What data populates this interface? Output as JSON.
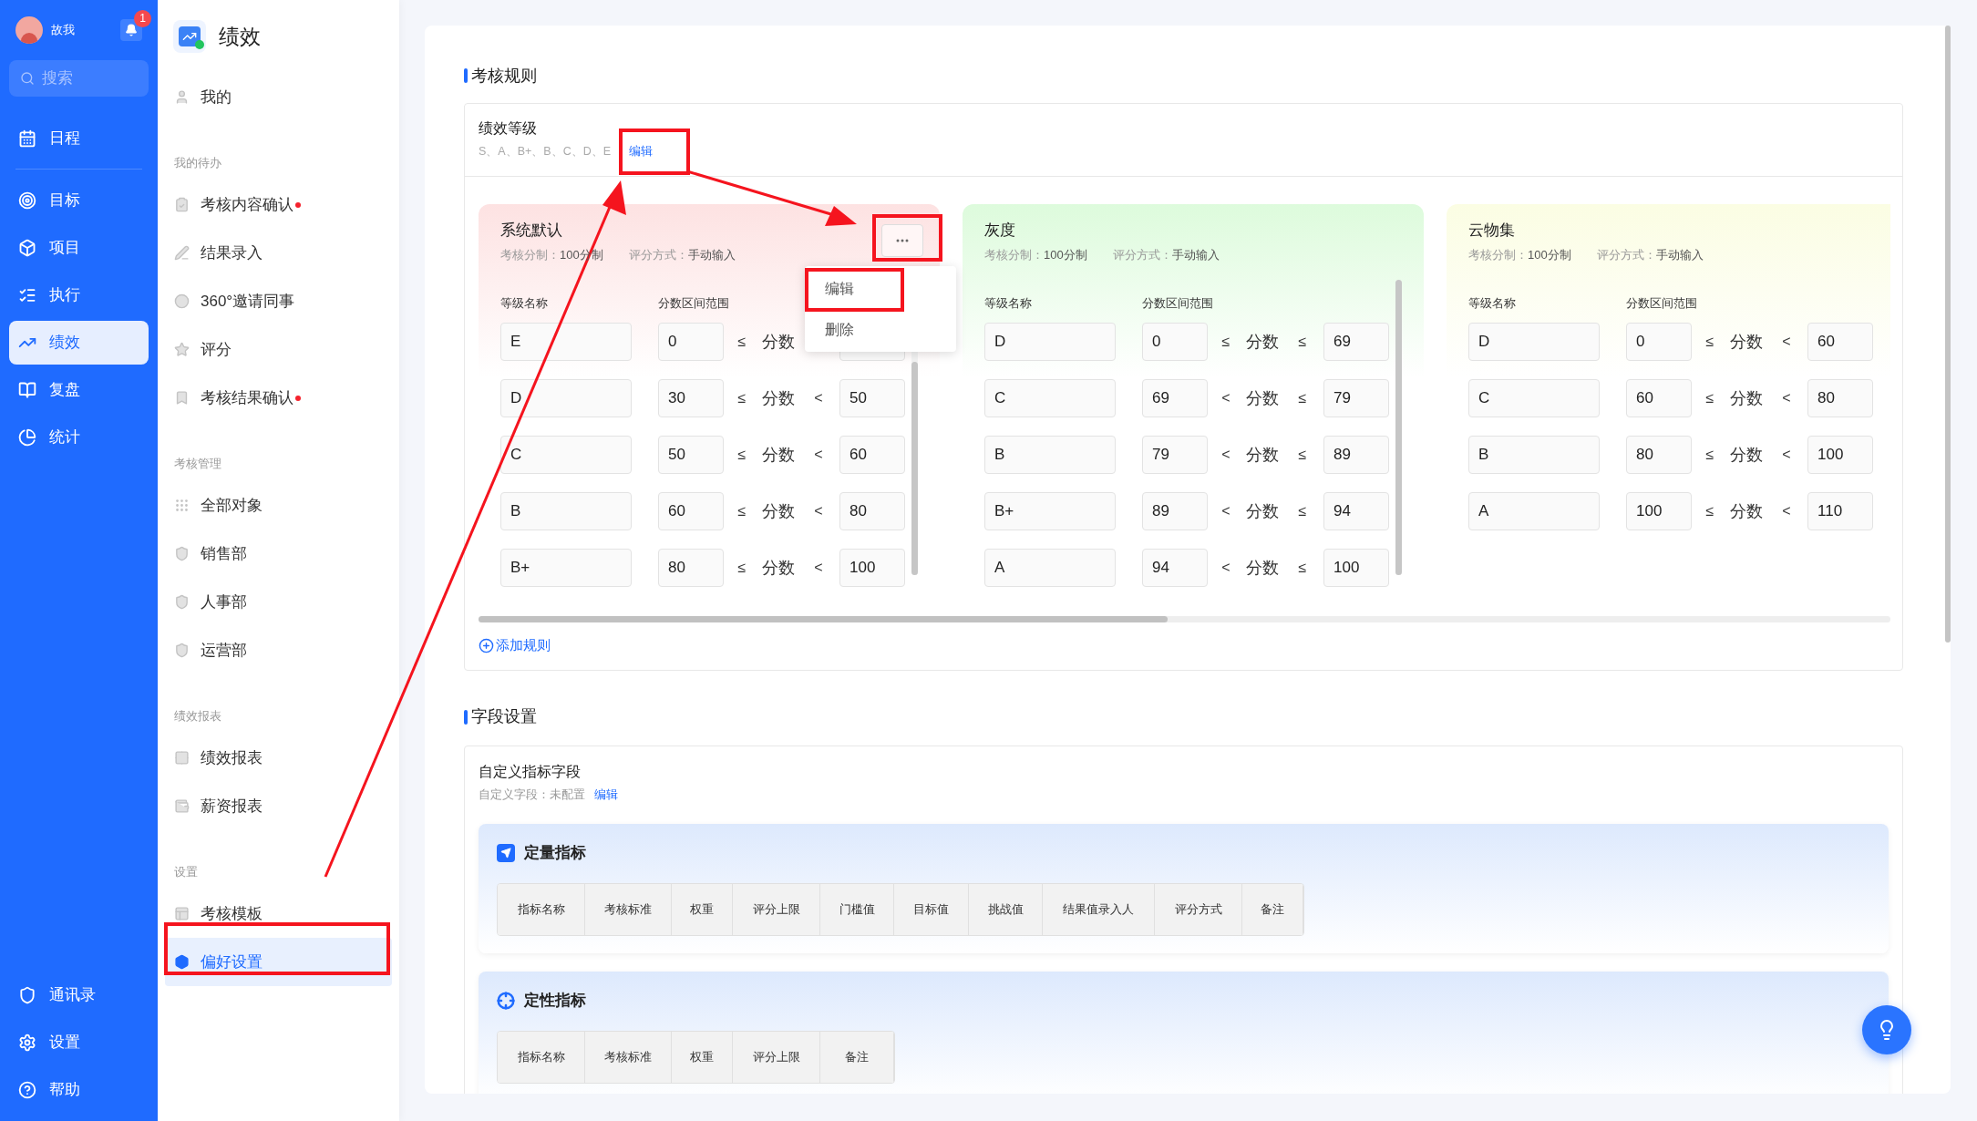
{
  "nav": {
    "user": {
      "name": "故我"
    },
    "notification_badge": "1",
    "search": {
      "placeholder": "搜索"
    },
    "top_items": [
      {
        "label": "日程",
        "selected": false
      }
    ],
    "items": [
      {
        "label": "目标",
        "selected": false
      },
      {
        "label": "项目",
        "selected": false
      },
      {
        "label": "执行",
        "selected": false
      },
      {
        "label": "绩效",
        "selected": true
      },
      {
        "label": "复盘",
        "selected": false
      },
      {
        "label": "统计",
        "selected": false
      }
    ],
    "bottom_items": [
      {
        "label": "通讯录"
      },
      {
        "label": "设置"
      },
      {
        "label": "帮助"
      }
    ]
  },
  "sidebar": {
    "title": "绩效",
    "groups": [
      {
        "items": [
          {
            "label": "我的",
            "unread": false,
            "selected": false
          }
        ]
      },
      {
        "heading": "我的待办",
        "items": [
          {
            "label": "考核内容确认",
            "unread": true,
            "selected": false
          },
          {
            "label": "结果录入",
            "unread": false,
            "selected": false
          },
          {
            "label": "360°邀请同事",
            "unread": false,
            "selected": false
          },
          {
            "label": "评分",
            "unread": false,
            "selected": false
          },
          {
            "label": "考核结果确认",
            "unread": true,
            "selected": false
          }
        ]
      },
      {
        "heading": "考核管理",
        "items": [
          {
            "label": "全部对象",
            "unread": false,
            "selected": false
          },
          {
            "label": "销售部",
            "unread": false,
            "selected": false
          },
          {
            "label": "人事部",
            "unread": false,
            "selected": false
          },
          {
            "label": "运营部",
            "unread": false,
            "selected": false
          }
        ]
      },
      {
        "heading": "绩效报表",
        "items": [
          {
            "label": "绩效报表",
            "unread": false,
            "selected": false
          },
          {
            "label": "薪资报表",
            "unread": false,
            "selected": false
          }
        ]
      },
      {
        "heading": "设置",
        "items": [
          {
            "label": "考核模板",
            "unread": false,
            "selected": false
          },
          {
            "label": "偏好设置",
            "unread": false,
            "selected": true
          }
        ]
      }
    ]
  },
  "rules": {
    "title": "考核规则",
    "grade_setting": {
      "title": "绩效等级",
      "grades": "S、A、B+、B、C、D、E",
      "edit_link": "编辑"
    },
    "cards": [
      {
        "name": "系统默认",
        "color": "#fde2e2",
        "scoring_label": "考核分制：",
        "scoring": "100分制",
        "method_label": "评分方式：",
        "method": "手动输入",
        "columns": [
          "等级名称",
          "分数区间范围"
        ],
        "menu": {
          "items": [
            "编辑",
            "删除"
          ]
        },
        "rows": [
          {
            "name": "E",
            "lower": "0",
            "lower_op": "≤",
            "field": "分数"
          },
          {
            "name": "D",
            "lower": "30",
            "lower_op": "≤",
            "field": "分数",
            "upper_op": "<",
            "upper": "50"
          },
          {
            "name": "C",
            "lower": "50",
            "lower_op": "≤",
            "field": "分数",
            "upper_op": "<",
            "upper": "60"
          },
          {
            "name": "B",
            "lower": "60",
            "lower_op": "≤",
            "field": "分数",
            "upper_op": "<",
            "upper": "80"
          },
          {
            "name": "B+",
            "lower": "80",
            "lower_op": "≤",
            "field": "分数",
            "upper_op": "<",
            "upper": "100"
          }
        ]
      },
      {
        "name": "灰度",
        "color": "#ddfbdc",
        "scoring_label": "考核分制：",
        "scoring": "100分制",
        "method_label": "评分方式：",
        "method": "手动输入",
        "columns": [
          "等级名称",
          "分数区间范围"
        ],
        "rows": [
          {
            "name": "D",
            "lower": "0",
            "lower_op": "≤",
            "field": "分数",
            "upper_op": "≤",
            "upper": "69"
          },
          {
            "name": "C",
            "lower": "69",
            "lower_op": "<",
            "field": "分数",
            "upper_op": "≤",
            "upper": "79"
          },
          {
            "name": "B",
            "lower": "79",
            "lower_op": "<",
            "field": "分数",
            "upper_op": "≤",
            "upper": "89"
          },
          {
            "name": "B+",
            "lower": "89",
            "lower_op": "<",
            "field": "分数",
            "upper_op": "≤",
            "upper": "94"
          },
          {
            "name": "A",
            "lower": "94",
            "lower_op": "<",
            "field": "分数",
            "upper_op": "≤",
            "upper": "100"
          }
        ]
      },
      {
        "name": "云物集",
        "color": "#fbfde3",
        "scoring_label": "考核分制：",
        "scoring": "100分制",
        "method_label": "评分方式：",
        "method": "手动输入",
        "columns": [
          "等级名称",
          "分数区间范围"
        ],
        "rows": [
          {
            "name": "D",
            "lower": "0",
            "lower_op": "≤",
            "field": "分数",
            "upper_op": "<",
            "upper": "60"
          },
          {
            "name": "C",
            "lower": "60",
            "lower_op": "≤",
            "field": "分数",
            "upper_op": "<",
            "upper": "80"
          },
          {
            "name": "B",
            "lower": "80",
            "lower_op": "≤",
            "field": "分数",
            "upper_op": "<",
            "upper": "100"
          },
          {
            "name": "A",
            "lower": "100",
            "lower_op": "≤",
            "field": "分数",
            "upper_op": "<",
            "upper": "110"
          }
        ]
      }
    ],
    "add_rule": "添加规则"
  },
  "fields": {
    "title": "字段设置",
    "custom": {
      "title": "自定义指标字段",
      "label": "自定义字段：",
      "value": "未配置",
      "edit_link": "编辑"
    },
    "groups": [
      {
        "kind": "quantitative",
        "title": "定量指标",
        "columns": [
          "指标名称",
          "考核标准",
          "权重",
          "评分上限",
          "门槛值",
          "目标值",
          "挑战值",
          "结果值录入人",
          "评分方式",
          "备注"
        ]
      },
      {
        "kind": "qualitative",
        "title": "定性指标",
        "columns": [
          "指标名称",
          "考核标准",
          "权重",
          "评分上限",
          "备注"
        ]
      }
    ]
  }
}
